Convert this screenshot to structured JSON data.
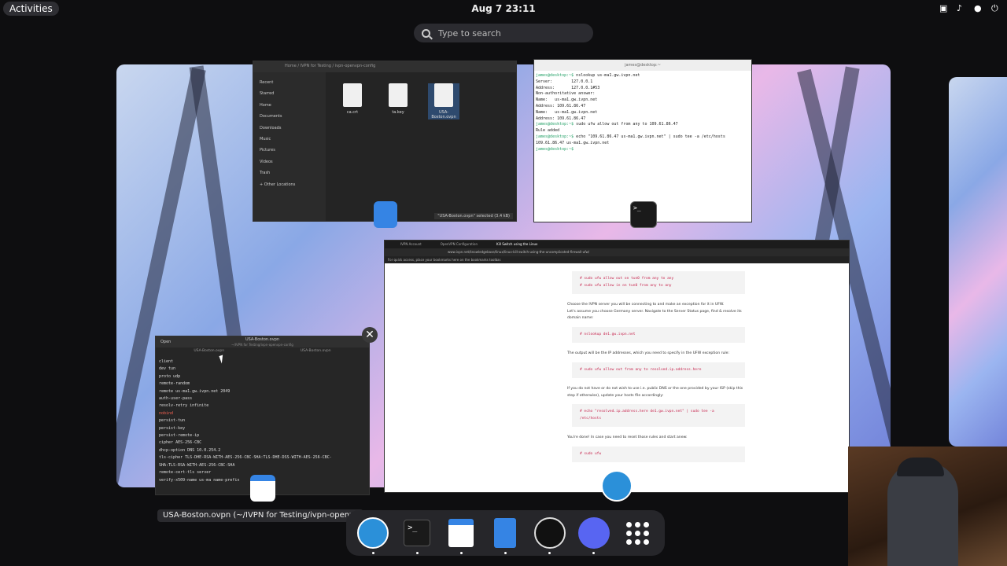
{
  "topbar": {
    "activities": "Activities",
    "clock": "Aug 7  23:11"
  },
  "search": {
    "placeholder": "Type to search"
  },
  "files_window": {
    "path": "Home  /  IVPN for Testing  /  ivpn-openvpn-config",
    "sidebar": [
      "Recent",
      "Starred",
      "Home",
      "Documents",
      "Downloads",
      "Music",
      "Pictures",
      "Videos",
      "Trash",
      "+ Other Locations"
    ],
    "files": [
      "ca.crt",
      "ta.key",
      "USA-Boston.ovpn"
    ],
    "status": "\"USA-Boston.ovpn\" selected (3.4 kB)"
  },
  "terminal_window": {
    "title": "james@desktop:~",
    "lines": [
      {
        "prompt": "james@desktop:~$",
        "text": " nslookup us-ma1.gw.ivpn.net"
      },
      {
        "prompt": "",
        "text": "Server:        127.0.0.1"
      },
      {
        "prompt": "",
        "text": "Address:       127.0.0.1#53"
      },
      {
        "prompt": "",
        "text": ""
      },
      {
        "prompt": "",
        "text": "Non-authoritative answer:"
      },
      {
        "prompt": "",
        "text": "Name:   us-ma1.gw.ivpn.net"
      },
      {
        "prompt": "",
        "text": "Address: 109.61.86.47"
      },
      {
        "prompt": "",
        "text": "Name:   us-ma1.gw.ivpn.net"
      },
      {
        "prompt": "",
        "text": "Address: 109.61.86.47"
      },
      {
        "prompt": "",
        "text": ""
      },
      {
        "prompt": "james@desktop:~$",
        "text": " sudo ufw allow out from any to 109.61.86.47"
      },
      {
        "prompt": "",
        "text": "Rule added"
      },
      {
        "prompt": "james@desktop:~$",
        "text": " echo \"109.61.86.47 us-ma1.gw.ivpn.net\" | sudo tee -a /etc/hosts"
      },
      {
        "prompt": "",
        "text": "109.61.86.47 us-ma1.gw.ivpn.net"
      },
      {
        "prompt": "james@desktop:~$",
        "text": " "
      }
    ]
  },
  "browser_window": {
    "tabs": [
      "IVPN Account",
      "OpenVPN Configuration",
      "Kill Switch using the Linux"
    ],
    "url": "www.ivpn.net/knowledgebase/linux/linux-kill-switch-using-the-uncomplicated-firewall-ufw/",
    "bookmarks_bar": "For quick access, place your bookmarks here on the bookmarks toolbar.",
    "code1": [
      "# sudo ufw allow out on tun0 from any to any",
      "# sudo ufw allow in on tun0 from any to any"
    ],
    "step5": "Choose the IVPN server you will be connecting to and make an exception for it in UFW.",
    "step5b": "Let's assume you choose Germany server. Navigate to the Server Status page, find & resolve its domain name:",
    "code2": "# nslookup de1.gw.ivpn.net",
    "para2": "The output will be the IP addresses, which you need to specify in the UFW exception rule:",
    "code3": "# sudo ufw allow out from any to resolved.ip.address.here",
    "para3": "If you do not have or do not wish to use i.e. public DNS or the one provided by your ISP (skip this step if otherwise), update your hosts file accordingly:",
    "code4": "# echo \"resolved.ip.address.here  de1.gw.ivpn.net\" | sudo tee -a /etc/hosts",
    "step6": "You're done! In case you need to reset those rules and start anew:",
    "code5": "# sudo ufw"
  },
  "editor_window": {
    "open_label": "Open",
    "title": "USA-Boston.ovpn",
    "subtitle": "~/IVPN for Testing/ivpn-openvpn-config",
    "tabs": [
      "USA-Boston.ovpn",
      "USA-Boston.ovpn"
    ],
    "lines": [
      "client",
      "dev tun",
      "proto udp",
      "remote-random",
      "remote us-ma1.gw.ivpn.net 2049",
      "auth-user-pass",
      "resolv-retry infinite",
      "nobind",
      "persist-tun",
      "persist-key",
      "persist-remote-ip",
      "cipher AES-256-CBC",
      "dhcp-option DNS 10.0.254.2",
      "tls-cipher TLS-DHE-RSA-WITH-AES-256-CBC-SHA:TLS-DHE-DSS-WITH-AES-256-CBC-",
      "SHA:TLS-RSA-WITH-AES-256-CBC-SHA",
      "remote-cert-tls server",
      "verify-x509-name us-ma name-prefix"
    ]
  },
  "caption": "USA-Boston.ovpn (~/IVPN for Testing/ivpn-openvpn-con...",
  "close_symbol": "✕",
  "dock": {
    "apps": [
      "ivpn-icon",
      "terminal-icon",
      "text-editor-icon",
      "document-viewer-icon",
      "obs-icon",
      "discord-icon",
      "app-grid-icon"
    ],
    "terminal_glyph": ">_"
  }
}
